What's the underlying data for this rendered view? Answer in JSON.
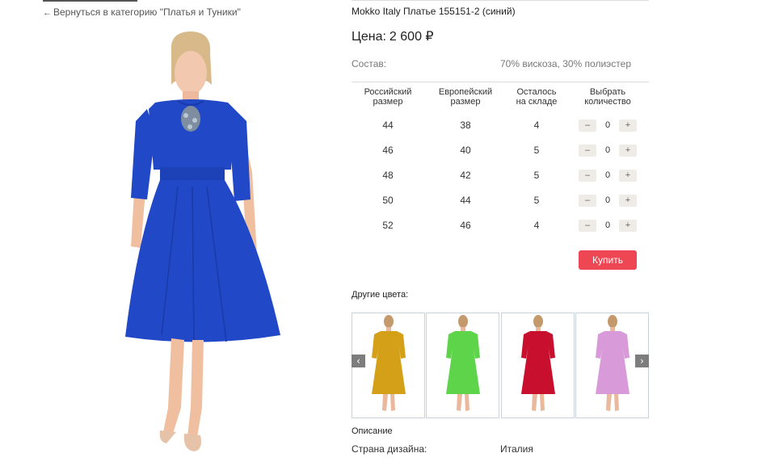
{
  "nav": {
    "back_arrow": "←",
    "back_text": "Вернуться в категорию \"Платья и Туники\""
  },
  "product": {
    "title": "Mokko Italy Платье 155151-2 (синий)",
    "price_label": "Цена:",
    "price_value": "2 600 ₽",
    "composition_label": "Состав:",
    "composition_value": "70% вискоза, 30% полиэстер",
    "main_color": "#2148c6"
  },
  "sizes_table": {
    "headers": {
      "ru_line1": "Российский",
      "ru_line2": "размер",
      "eu_line1": "Европейский",
      "eu_line2": "размер",
      "stock_line1": "Осталось",
      "stock_line2": "на складе",
      "qty_line1": "Выбрать",
      "qty_line2": "количество"
    },
    "rows": [
      {
        "ru": "44",
        "eu": "38",
        "stock": "4",
        "qty": "0"
      },
      {
        "ru": "46",
        "eu": "40",
        "stock": "5",
        "qty": "0"
      },
      {
        "ru": "48",
        "eu": "42",
        "stock": "5",
        "qty": "0"
      },
      {
        "ru": "50",
        "eu": "44",
        "stock": "5",
        "qty": "0"
      },
      {
        "ru": "52",
        "eu": "46",
        "stock": "4",
        "qty": "0"
      }
    ],
    "minus_symbol": "–",
    "plus_symbol": "+"
  },
  "buy_button": {
    "label": "Купить",
    "color": "#ee4652"
  },
  "other_colors": {
    "title": "Другие цвета:",
    "swatches": [
      {
        "name": "mustard",
        "color": "#d4a017"
      },
      {
        "name": "green",
        "color": "#5ed44a"
      },
      {
        "name": "red",
        "color": "#c8102e"
      },
      {
        "name": "lilac",
        "color": "#d89ad8"
      }
    ],
    "prev_icon": "chevron-left-icon",
    "next_icon": "chevron-right-icon",
    "prev_symbol": "‹",
    "next_symbol": "›"
  },
  "description": {
    "title": "Описание",
    "design_country_label": "Страна дизайна:",
    "design_country_value": "Италия"
  }
}
